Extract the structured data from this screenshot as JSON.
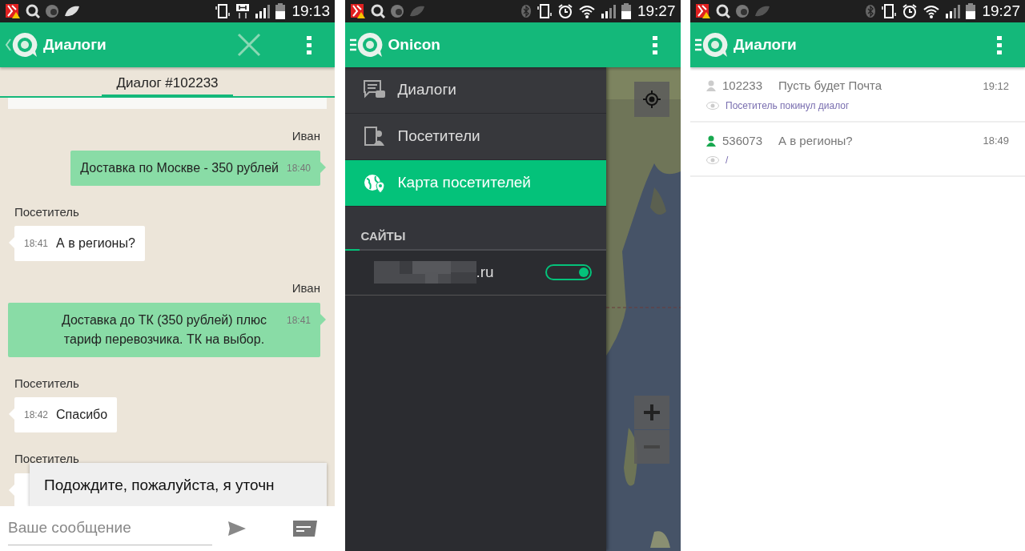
{
  "chat_screen": {
    "status_bar": {
      "time": "19:13"
    },
    "app_bar": {
      "title": "Диалоги"
    },
    "tab": {
      "label": "Диалог #102233",
      "selected": true
    },
    "messages": [
      {
        "kind": "cut"
      },
      {
        "kind": "outgoing",
        "sender": "Иван",
        "text": "Доставка по Москве - 350 рублей",
        "time": "18:40"
      },
      {
        "kind": "incoming",
        "sender": "Посетитель",
        "text": "А в регионы?",
        "time": "18:41"
      },
      {
        "kind": "outgoing",
        "sender": "Иван",
        "text": "Доставка до ТК (350 рублей) плюс тариф перевозчика. ТК на выбор.",
        "time": "18:41"
      },
      {
        "kind": "incoming",
        "sender": "Посетитель",
        "text": "Спасибо",
        "time": "18:42"
      },
      {
        "kind": "hidden",
        "sender": "Посетитель"
      }
    ],
    "suggestion": "Подождите, пожалуйста, я уточн",
    "input": {
      "placeholder": "Ваше сообщение"
    }
  },
  "menu_screen": {
    "status_bar": {
      "time": "19:27"
    },
    "app_bar": {
      "title": "Onicon"
    },
    "drawer_items": [
      {
        "kind": "dialogs",
        "label": "Диалоги",
        "selected": false
      },
      {
        "kind": "visitors",
        "label": "Посетители",
        "selected": false
      },
      {
        "kind": "map",
        "label": "Карта посетителей",
        "selected": true
      }
    ],
    "section_title": "САЙТЫ",
    "sites": [
      {
        "domain": ".ru",
        "on": true
      }
    ]
  },
  "list_screen": {
    "status_bar": {
      "time": "19:27"
    },
    "app_bar": {
      "title": "Диалоги"
    },
    "dialogs": [
      {
        "number": "102233",
        "message": "Пусть будет Почта",
        "time": "19:12",
        "status": "Посетитель покинул диалог",
        "online": false
      },
      {
        "number": "536073",
        "message": "А в регионы?",
        "time": "18:49",
        "status": "/",
        "online": true
      }
    ]
  }
}
